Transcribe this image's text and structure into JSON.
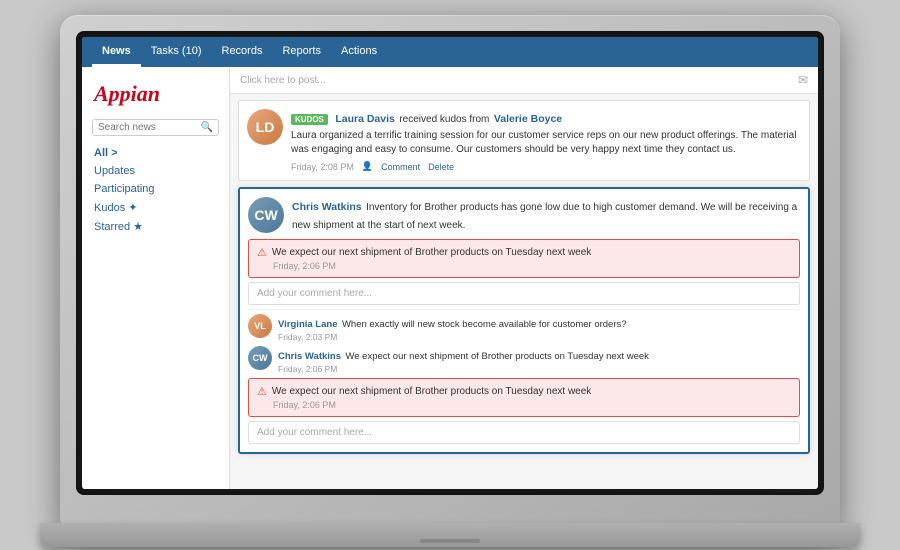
{
  "nav": {
    "tabs": [
      {
        "label": "News",
        "active": true
      },
      {
        "label": "Tasks (10)",
        "active": false
      },
      {
        "label": "Records",
        "active": false
      },
      {
        "label": "Reports",
        "active": false
      },
      {
        "label": "Actions",
        "active": false
      }
    ]
  },
  "sidebar": {
    "logo": "Appian",
    "search_placeholder": "Search news",
    "all_label": "All >",
    "items": [
      {
        "label": "Updates"
      },
      {
        "label": "Participating"
      },
      {
        "label": "Kudos ✦"
      },
      {
        "label": "Starred ★"
      }
    ]
  },
  "post_bar": {
    "placeholder": "Click here to post...",
    "icon": "✉"
  },
  "feed": {
    "items": [
      {
        "id": "kudos-post",
        "avatar_initials": "LD",
        "avatar_class": "avatar-ld",
        "kudos_badge": "KUDOS",
        "name": "Laura Davis",
        "received_text": "received kudos from",
        "from_name": "Valerie Boyce",
        "body": "Laura organized a terrific training session for our customer service reps on our new product offerings. The material was engaging and easy to consume. Our customers should be very happy next time they contact us.",
        "time": "Friday, 2:08 PM",
        "actions": [
          "Comment",
          "Delete"
        ]
      },
      {
        "id": "chris-post",
        "avatar_initials": "CW",
        "avatar_class": "avatar-cw",
        "name": "Chris Watkins",
        "body": "Inventory for Brother products has gone low due to high customer demand. We will be receiving a new shipment at the start of next week.",
        "focused": true,
        "error_message": "We expect our next shipment of Brother products on Tuesday next week",
        "error_time": "Friday, 2:06 PM",
        "comment_placeholder": "Add your comment here...",
        "comments": [
          {
            "avatar_initials": "VL",
            "avatar_class": "avatar-ld",
            "name": "Virginia Lane",
            "text": "When exactly will new stock become available for customer orders?",
            "time": "Friday, 2:03 PM"
          },
          {
            "avatar_initials": "CW",
            "avatar_class": "avatar-cw",
            "name": "Chris Watkins",
            "text": "We expect our next shipment of Brother products on Tuesday next week",
            "time": "Friday, 2:06 PM"
          }
        ],
        "error_message2": "We expect our next shipment of Brother products on Tuesday next week",
        "error_time2": "Friday, 2:06 PM",
        "comment_placeholder2": "Add your comment here..."
      }
    ]
  }
}
